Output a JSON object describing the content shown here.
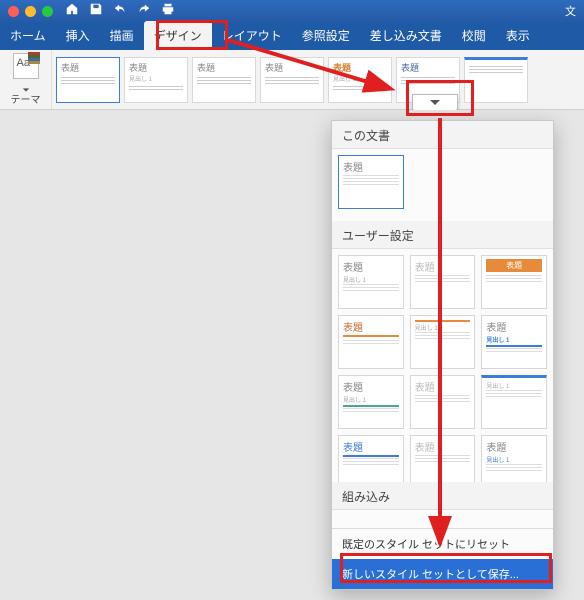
{
  "titlebar": {
    "doc_indicator": "文"
  },
  "ribbon": {
    "tabs": [
      "ホーム",
      "挿入",
      "描画",
      "デザイン",
      "レイアウト",
      "参照設定",
      "差し込み文書",
      "校閲",
      "表示"
    ],
    "active_index": 3
  },
  "theme_group": {
    "label": "テーマ"
  },
  "gallery": {
    "title_word": "表題",
    "sub_word": "見出し 1"
  },
  "dropdown": {
    "section_this_doc": "この文書",
    "section_user": "ユーザー設定",
    "section_builtin": "組み込み",
    "footer_reset": "既定のスタイル セットにリセット",
    "footer_save": "新しいスタイル セットとして保存...",
    "title_word": "表題",
    "sub_word": "見出し 1"
  }
}
